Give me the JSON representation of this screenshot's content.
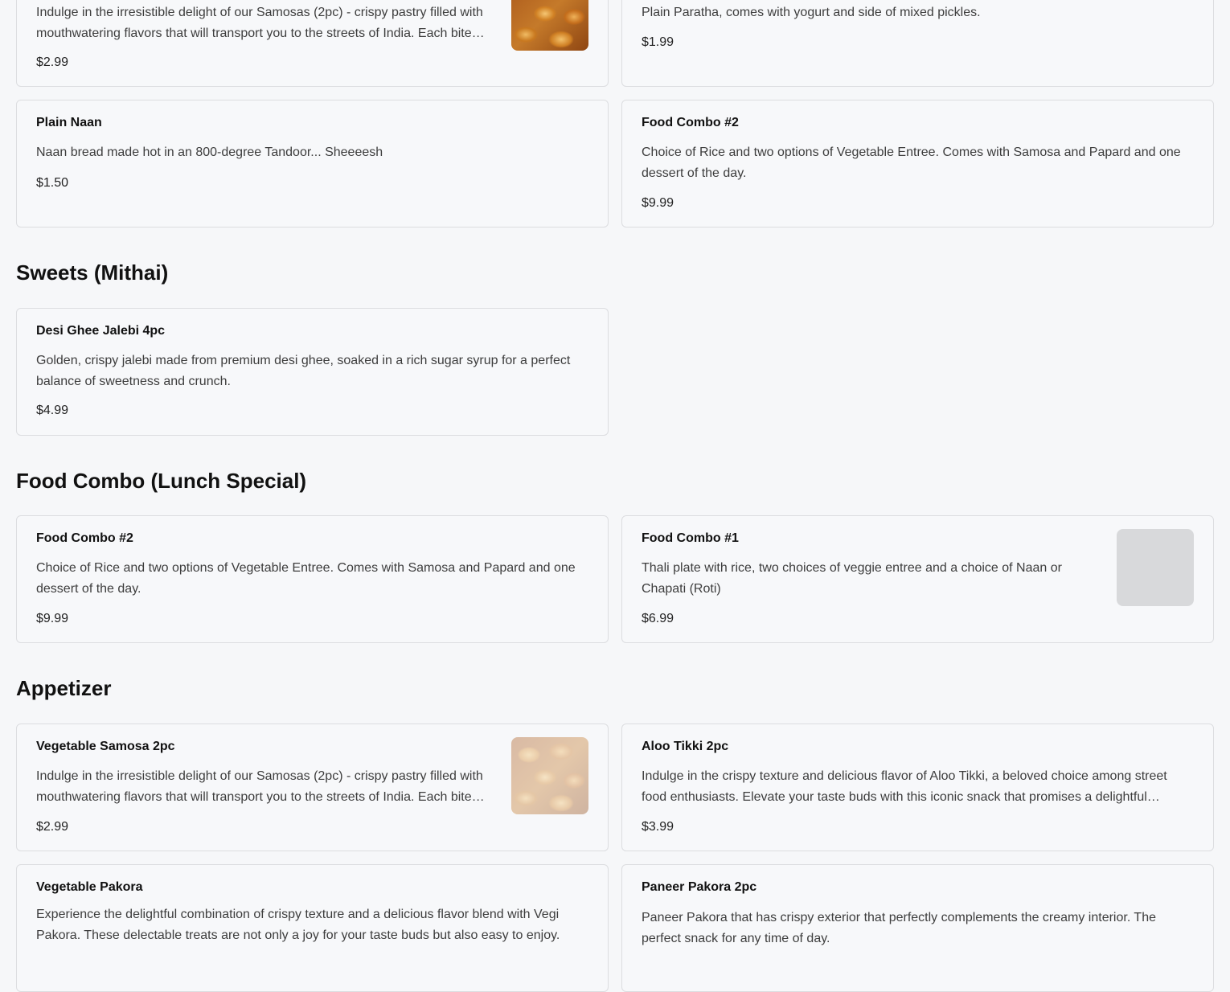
{
  "items": {
    "samosa_top": {
      "name": "",
      "desc": "Indulge in the irresistible delight of our Samosas (2pc) - crispy pastry filled with mouthwatering flavors that will transport you to the streets of India. Each bite bursts with flavor.",
      "price": "$2.99"
    },
    "paratha_top": {
      "name": "",
      "desc": "Plain Paratha, comes with yogurt and side of mixed pickles.",
      "price": "$1.99"
    },
    "plain_naan": {
      "name": "Plain Naan",
      "desc": "Naan bread made hot in an 800-degree Tandoor... Sheeeesh",
      "price": "$1.50"
    },
    "combo2_top": {
      "name": "Food Combo #2",
      "desc": "Choice of Rice and two options of Vegetable Entree. Comes with Samosa and Papard and one dessert of the day.",
      "price": "$9.99"
    },
    "jalebi": {
      "name": "Desi Ghee Jalebi 4pc",
      "desc": "Golden, crispy jalebi made from premium desi ghee, soaked in a rich sugar syrup for a perfect balance of sweetness and crunch.",
      "price": "$4.99"
    },
    "combo2": {
      "name": "Food Combo #2",
      "desc": "Choice of Rice and two options of Vegetable Entree. Comes with Samosa and Papard and one dessert of the day.",
      "price": "$9.99"
    },
    "combo1": {
      "name": "Food Combo #1",
      "desc": "Thali plate with rice, two choices of veggie entree and a choice of Naan or Chapati (Roti)",
      "price": "$6.99"
    },
    "veg_samosa": {
      "name": "Vegetable Samosa 2pc",
      "desc": "Indulge in the irresistible delight of our Samosas (2pc) - crispy pastry filled with mouthwatering flavors that will transport you to the streets of India. Each bite bursts with flavor.",
      "price": "$2.99"
    },
    "aloo_tikki": {
      "name": "Aloo Tikki 2pc",
      "desc": "Indulge in the crispy texture and delicious flavor of Aloo Tikki, a beloved choice among street food enthusiasts. Elevate your taste buds with this iconic snack that promises a delightful experience.",
      "price": "$3.99"
    },
    "veg_pakora": {
      "name": "Vegetable Pakora",
      "desc": "Experience the delightful combination of crispy texture and a delicious flavor blend with Vegi Pakora. These delectable treats are not only a joy for your taste buds but also easy to enjoy.",
      "price": ""
    },
    "paneer_pakora": {
      "name": "Paneer Pakora 2pc",
      "desc": "Paneer Pakora that has crispy exterior that perfectly complements the creamy interior. The perfect snack for any time of day.",
      "price": ""
    }
  },
  "sections": {
    "sweets": "Sweets (Mithai)",
    "combo": "Food Combo (Lunch Special)",
    "appetizer": "Appetizer"
  },
  "images": {
    "samosa_photo": "samosa-photo",
    "placeholder": "image-placeholder"
  },
  "colors": {
    "page_bg": "#f6f7f9",
    "card_border": "#dcdde0",
    "placeholder": "#d8d9db"
  }
}
